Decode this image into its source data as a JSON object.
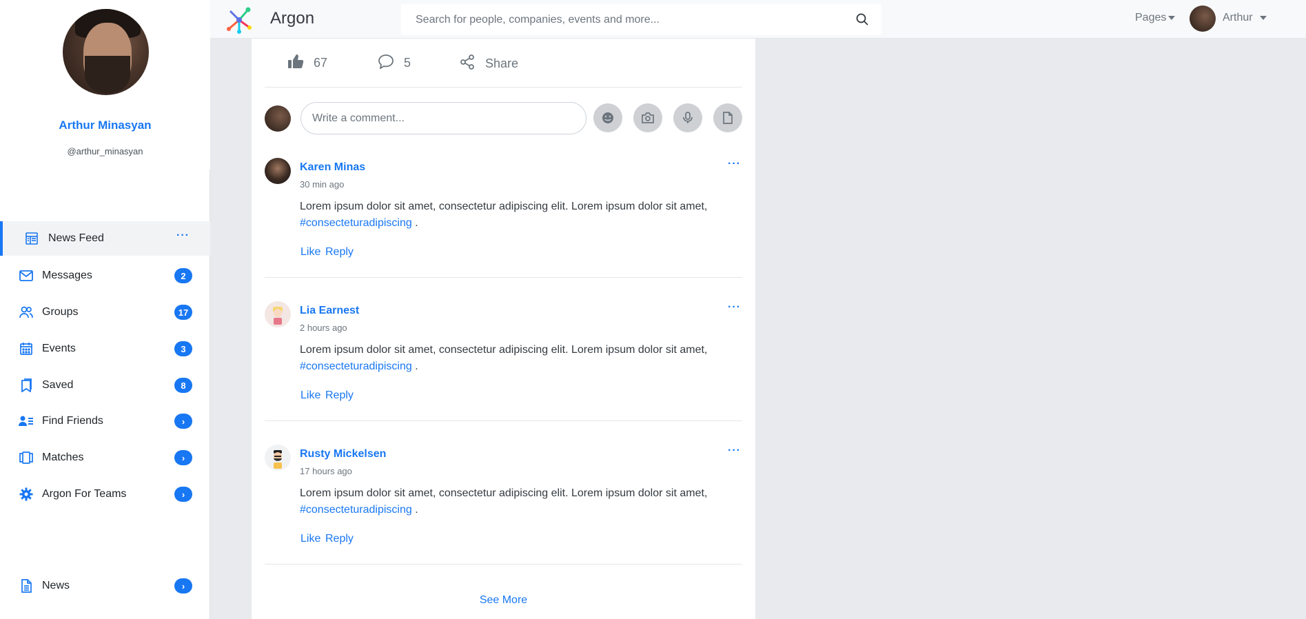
{
  "app": {
    "brand": "Argon"
  },
  "search": {
    "placeholder": "Search for people, companies, events and more..."
  },
  "topbar": {
    "pages_label": "Pages",
    "user_label": "Arthur"
  },
  "profile": {
    "name": "Arthur Minasyan",
    "handle": "@arthur_minasyan"
  },
  "sidebar": {
    "items": [
      {
        "label": "News Feed",
        "icon": "newsfeed-icon",
        "active": true,
        "more": "···"
      },
      {
        "label": "Messages",
        "icon": "mail-icon",
        "badge": "2"
      },
      {
        "label": "Groups",
        "icon": "users-icon",
        "badge": "17"
      },
      {
        "label": "Events",
        "icon": "calendar-icon",
        "badge": "3"
      },
      {
        "label": "Saved",
        "icon": "bookmark-icon",
        "badge": "8"
      },
      {
        "label": "Find Friends",
        "icon": "user-list-icon",
        "badge": "›"
      },
      {
        "label": "Matches",
        "icon": "cards-icon",
        "badge": "›"
      },
      {
        "label": "Argon For Teams",
        "icon": "gear-icon",
        "badge": "›"
      },
      {
        "label": "News",
        "icon": "document-icon",
        "badge": "›"
      }
    ]
  },
  "post": {
    "likes": "67",
    "comments_count": "5",
    "share_label": "Share",
    "comment_placeholder": "Write a comment...",
    "comment_tools": [
      "emoji-icon",
      "camera-icon",
      "microphone-icon",
      "file-icon"
    ]
  },
  "comments": [
    {
      "name": "Karen Minas",
      "time": "30 min ago",
      "text": "Lorem ipsum dolor sit amet, consectetur adipiscing elit. Lorem ipsum dolor sit amet,",
      "tag": "#consecteturadipiscing",
      "after": " .",
      "like": "Like",
      "reply": "Reply",
      "more": "···"
    },
    {
      "name": "Lia Earnest",
      "time": "2 hours ago",
      "text": "Lorem ipsum dolor sit amet, consectetur adipiscing elit. Lorem ipsum dolor sit amet,",
      "tag": "#consecteturadipiscing",
      "after": " .",
      "like": "Like",
      "reply": "Reply",
      "more": "···"
    },
    {
      "name": "Rusty Mickelsen",
      "time": "17 hours ago",
      "text": "Lorem ipsum dolor sit amet, consectetur adipiscing elit. Lorem ipsum dolor sit amet,",
      "tag": "#consecteturadipiscing",
      "after": " .",
      "like": "Like",
      "reply": "Reply",
      "more": "···"
    }
  ],
  "see_more": "See More",
  "colors": {
    "accent": "#1877f2",
    "sidebar_bg": "#ffffff",
    "page_bg": "#e9eaee"
  }
}
